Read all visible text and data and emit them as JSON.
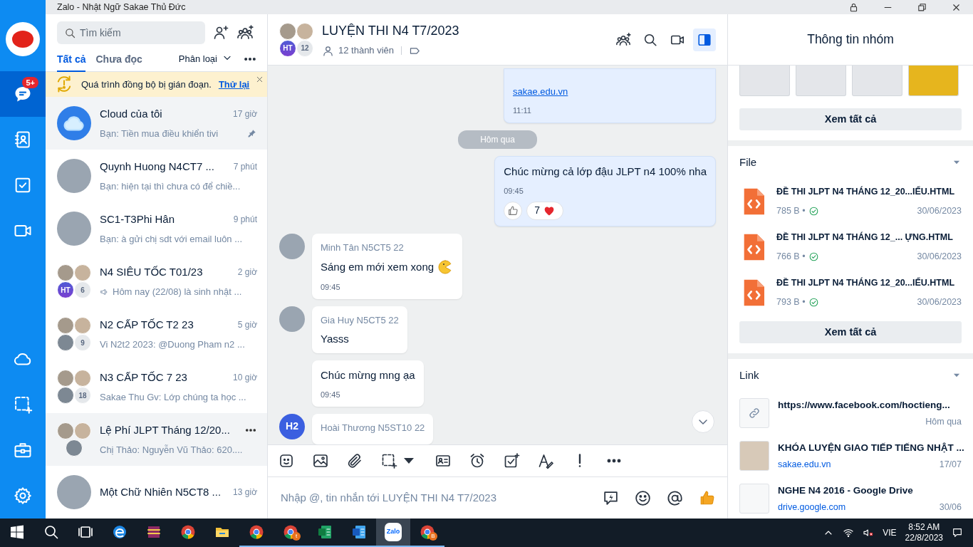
{
  "window": {
    "title": "Zalo - Nhật Ngữ Sakae Thủ Đức"
  },
  "nav": {
    "top_items": [
      {
        "kind": "chat",
        "selected": true,
        "badge": "5+"
      },
      {
        "kind": "contacts",
        "selected": false
      },
      {
        "kind": "todo",
        "selected": false
      },
      {
        "kind": "video",
        "selected": false
      }
    ],
    "bottom_items": [
      {
        "kind": "cloud",
        "selected": false
      },
      {
        "kind": "screenshot",
        "selected": false
      },
      {
        "kind": "toolbox",
        "selected": false
      },
      {
        "kind": "settings",
        "selected": false
      }
    ]
  },
  "sidebar": {
    "search": {
      "placeholder": "Tìm kiếm"
    },
    "tabs": [
      {
        "label": "Tất cả",
        "selected": true
      },
      {
        "label": "Chưa đọc",
        "selected": false
      }
    ],
    "filter": "Phân loại",
    "banner": {
      "text": "Quá trình đồng bộ bị gián đoạn.",
      "action": "Thử lại"
    },
    "conversations": [
      {
        "name": "Cloud của tôi",
        "time": "17 giờ",
        "preview": "Bạn: Tiền mua điều khiển tivi",
        "pinned": true,
        "highlighted": true,
        "avatar": {
          "kind": "cloud"
        }
      },
      {
        "name": "Quynh Huong  N4CT7 ...",
        "time": "7 phút",
        "preview": "Bạn: hiện tại thì chưa có để chiề...",
        "pinned": false,
        "highlighted": false,
        "avatar": {
          "kind": "photo"
        }
      },
      {
        "name": "SC1-T3Phi Hân",
        "time": "9 phút",
        "preview": "Bạn: à gửi chị sdt với email luôn ...",
        "pinned": false,
        "highlighted": false,
        "avatar": {
          "kind": "photo"
        }
      },
      {
        "name": "N4 SIÊU TỐC T01/23",
        "time": "2 giờ",
        "preview": "Hôm nay (22/08) là sinh nhật ...",
        "announcement": true,
        "pinned": false,
        "highlighted": false,
        "avatar": {
          "kind": "group",
          "initials": "HT",
          "count": "6"
        }
      },
      {
        "name": "N2 CẤP TỐC T2 23",
        "time": "5 giờ",
        "preview": "Vi N2t2 2023: @Duong Pham n2 ...",
        "pinned": false,
        "highlighted": false,
        "avatar": {
          "kind": "group",
          "count": "9"
        }
      },
      {
        "name": "N3 CẤP TỐC 7 23",
        "time": "10 giờ",
        "preview": "Sakae Thu Gv: Lớp chúng ta học ...",
        "pinned": false,
        "highlighted": false,
        "avatar": {
          "kind": "group",
          "count": "18"
        }
      },
      {
        "name": "Lệ Phí JLPT Tháng 12/20...",
        "preview": "Chị Thảo: Nguyễn Vũ Thảo: 620....",
        "menu": true,
        "pinned": false,
        "highlighted": true,
        "avatar": {
          "kind": "group3"
        }
      },
      {
        "name": "Một Chữ Nhiên N5CT8 ...",
        "time": "13 giờ",
        "pinned": false,
        "highlighted": false,
        "avatar": {
          "kind": "photo"
        }
      }
    ]
  },
  "chat": {
    "title": "LUYỆN THI N4 T7/2023",
    "members": "12 thành viên",
    "avatar": {
      "kind": "group",
      "initials": "HT",
      "count": "12"
    },
    "actions": [
      {
        "kind": "add-group",
        "selected": false
      },
      {
        "kind": "search",
        "selected": false
      },
      {
        "kind": "video",
        "selected": false
      },
      {
        "kind": "panel",
        "selected": true
      }
    ],
    "messages": [
      {
        "kind": "outgoing",
        "link": "sakae.edu.vn",
        "time": "11:11"
      },
      {
        "kind": "divider",
        "text": "Hôm qua"
      },
      {
        "kind": "outgoing",
        "text": "Chúc mừng cả lớp đậu JLPT n4 100% nha",
        "time": "09:45",
        "reaction_count": "7"
      },
      {
        "kind": "incoming",
        "sender": "Minh Tân N5CT5 22",
        "avatar": {
          "kind": "photo"
        },
        "text": "Sáng em mới xem xong",
        "emoji": true,
        "time": "09:45"
      },
      {
        "kind": "incoming",
        "sender": "Gia Huy N5CT5 22",
        "avatar": {
          "kind": "photo"
        },
        "text": "Yasss"
      },
      {
        "kind": "incoming",
        "text": "Chúc mừng mng ạa",
        "time": "09:45"
      },
      {
        "kind": "incoming",
        "sender": "Hoài Thương N5ST10 22",
        "avatar": {
          "kind": "initials",
          "initials": "H2"
        }
      }
    ],
    "tools": [
      {
        "kind": "sticker"
      },
      {
        "kind": "image"
      },
      {
        "kind": "attach"
      },
      {
        "kind": "screenshot-menu"
      },
      {
        "kind": "contact-card"
      },
      {
        "kind": "alarm"
      },
      {
        "kind": "task"
      },
      {
        "kind": "text-format"
      },
      {
        "kind": "important"
      },
      {
        "kind": "more"
      }
    ],
    "input": {
      "placeholder": "Nhập @, tin nhắn tới LUYỆN THI N4 T7/2023"
    },
    "input_actions": [
      {
        "kind": "quick-message"
      },
      {
        "kind": "smiley"
      },
      {
        "kind": "mention"
      },
      {
        "kind": "thumbs-up"
      }
    ]
  },
  "info_panel": {
    "title": "Thông tin nhóm",
    "media": {
      "items": [
        {
          "kind": "photo"
        },
        {
          "kind": "photo"
        },
        {
          "kind": "photo"
        },
        {
          "kind": "photo"
        }
      ],
      "view_all": "Xem tất cả"
    },
    "files": {
      "title": "File",
      "expanded": true,
      "items": [
        {
          "name": "ĐỀ THI JLPT N4 THÁNG 12_20...IỂU.HTML",
          "size": "785 B •",
          "date": "30/06/2023",
          "synced": true
        },
        {
          "name": "ĐỀ THI JLPT N4 THÁNG 12_... ỰNG.HTML",
          "size": "766 B •",
          "date": "30/06/2023",
          "synced": true
        },
        {
          "name": "ĐỀ THI JLPT N4 THÁNG 12_20...IỂU.HTML",
          "size": "793 B •",
          "date": "30/06/2023",
          "synced": true
        }
      ],
      "view_all": "Xem tất cả"
    },
    "links": {
      "title": "Link",
      "expanded": true,
      "items": [
        {
          "kind": "url",
          "title": "https://www.facebook.com/hoctieng...",
          "date": "Hôm qua"
        },
        {
          "kind": "page",
          "title": "KHÓA LUYỆN GIAO TIẾP TIẾNG NHẬT ...",
          "domain": "sakae.edu.vn",
          "date": "17/07"
        },
        {
          "kind": "drive",
          "title": "NGHE N4 2016 - Google Drive",
          "domain": "drive.google.com",
          "date": "30/06"
        }
      ]
    }
  },
  "taskbar": {
    "apps": [
      {
        "kind": "start",
        "running": false,
        "selected": false
      },
      {
        "kind": "search",
        "running": false,
        "selected": false
      },
      {
        "kind": "taskview",
        "running": false,
        "selected": false
      },
      {
        "kind": "edge",
        "running": false,
        "selected": false
      },
      {
        "kind": "archive",
        "running": false,
        "selected": false
      },
      {
        "kind": "chrome",
        "running": false,
        "selected": false
      },
      {
        "kind": "folder",
        "running": false,
        "selected": false
      },
      {
        "kind": "chrome",
        "running": true,
        "selected": false
      },
      {
        "kind": "chrome",
        "running": true,
        "selected": false,
        "profile": "t"
      },
      {
        "kind": "excel",
        "running": true,
        "selected": false
      },
      {
        "kind": "word",
        "running": true,
        "selected": false
      },
      {
        "kind": "zalo",
        "label": "Zalo",
        "running": true,
        "selected": true
      },
      {
        "kind": "chrome",
        "running": true,
        "selected": false,
        "profile": "B"
      }
    ],
    "language": "VIE",
    "time": "8:52 AM",
    "date": "22/8/2023"
  }
}
